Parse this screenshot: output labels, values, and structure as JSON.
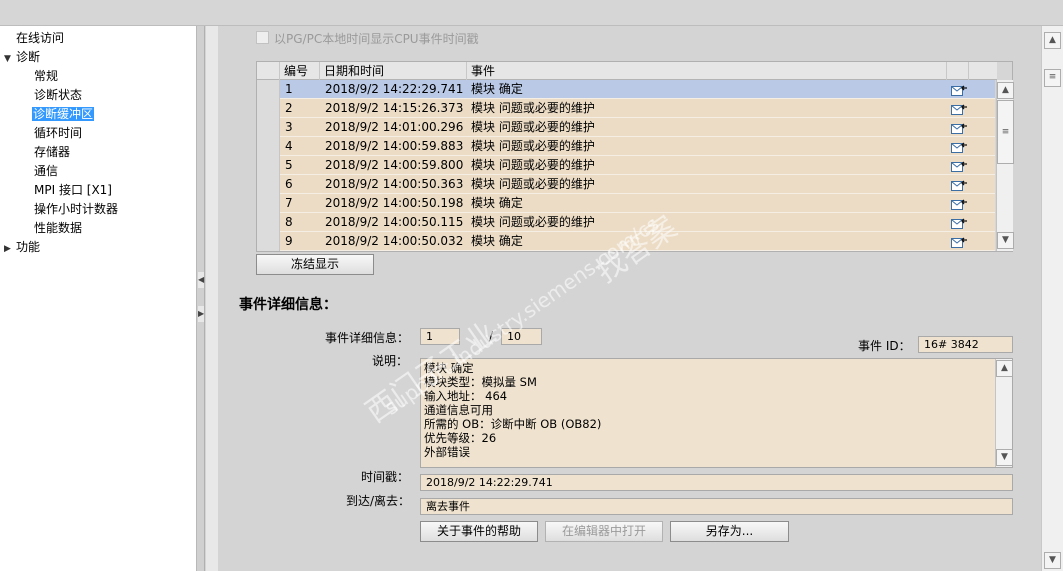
{
  "tree": {
    "items": [
      {
        "label": "在线访问",
        "indent": 0,
        "toggle": ""
      },
      {
        "label": "诊断",
        "indent": 0,
        "toggle": "▼"
      },
      {
        "label": "常规",
        "indent": 1,
        "toggle": ""
      },
      {
        "label": "诊断状态",
        "indent": 1,
        "toggle": ""
      },
      {
        "label": "诊断缓冲区",
        "indent": 1,
        "toggle": "",
        "selected": true
      },
      {
        "label": "循环时间",
        "indent": 1,
        "toggle": ""
      },
      {
        "label": "存储器",
        "indent": 1,
        "toggle": ""
      },
      {
        "label": "通信",
        "indent": 1,
        "toggle": ""
      },
      {
        "label": "MPI 接口 [X1]",
        "indent": 1,
        "toggle": ""
      },
      {
        "label": "操作小时计数器",
        "indent": 1,
        "toggle": ""
      },
      {
        "label": "性能数据",
        "indent": 1,
        "toggle": ""
      },
      {
        "label": "功能",
        "indent": 0,
        "toggle": "▶"
      }
    ]
  },
  "checkbox": {
    "label": "以PG/PC本地时间显示CPU事件时间戳",
    "checked": false
  },
  "grid": {
    "headers": {
      "num": "编号",
      "datetime": "日期和时间",
      "event": "事件"
    },
    "rows": [
      {
        "num": "1",
        "datetime": "2018/9/2 14:22:29.741",
        "event": "模块 确定"
      },
      {
        "num": "2",
        "datetime": "2018/9/2 14:15:26.373",
        "event": "模块 问题或必要的维护"
      },
      {
        "num": "3",
        "datetime": "2018/9/2 14:01:00.296",
        "event": "模块 问题或必要的维护"
      },
      {
        "num": "4",
        "datetime": "2018/9/2 14:00:59.883",
        "event": "模块 问题或必要的维护"
      },
      {
        "num": "5",
        "datetime": "2018/9/2 14:00:59.800",
        "event": "模块 问题或必要的维护"
      },
      {
        "num": "6",
        "datetime": "2018/9/2 14:00:50.363",
        "event": "模块 问题或必要的维护"
      },
      {
        "num": "7",
        "datetime": "2018/9/2 14:00:50.198",
        "event": "模块 确定"
      },
      {
        "num": "8",
        "datetime": "2018/9/2 14:00:50.115",
        "event": "模块 问题或必要的维护"
      },
      {
        "num": "9",
        "datetime": "2018/9/2 14:00:50.032",
        "event": "模块 确定"
      }
    ]
  },
  "freeze_button": "冻结显示",
  "details": {
    "heading": "事件详细信息：",
    "detail_label": "事件详细信息：",
    "detail_index": "1",
    "detail_sep": "/",
    "detail_total": "10",
    "event_id_label": "事件 ID：",
    "event_id": "16# 3842",
    "desc_label": "说明：",
    "desc_lines": [
      "模块 确定",
      "模块类型：模拟量 SM",
      "输入地址：   464",
      "通道信息可用",
      "所需的 OB：诊断中断 OB (OB82)",
      "优先等级：26",
      "外部错误"
    ],
    "timestamp_label": "时间戳：",
    "timestamp": "2018/9/2 14:22:29.741",
    "arrive_label": "到达/离去：",
    "arrive": "离去事件"
  },
  "buttons": {
    "help": "关于事件的帮助",
    "open_editor": "在编辑器中打开",
    "save_as": "另存为..."
  },
  "watermark": {
    "line1": "西门子工业",
    "line2": "support.industry.siemens.com/cs",
    "line3": "找答案"
  },
  "colors": {
    "row_bg": "#ecdcc5",
    "row_selected": "#b9c9e6",
    "field_bg": "#efe2cf",
    "tree_selected": "#3399ff"
  }
}
